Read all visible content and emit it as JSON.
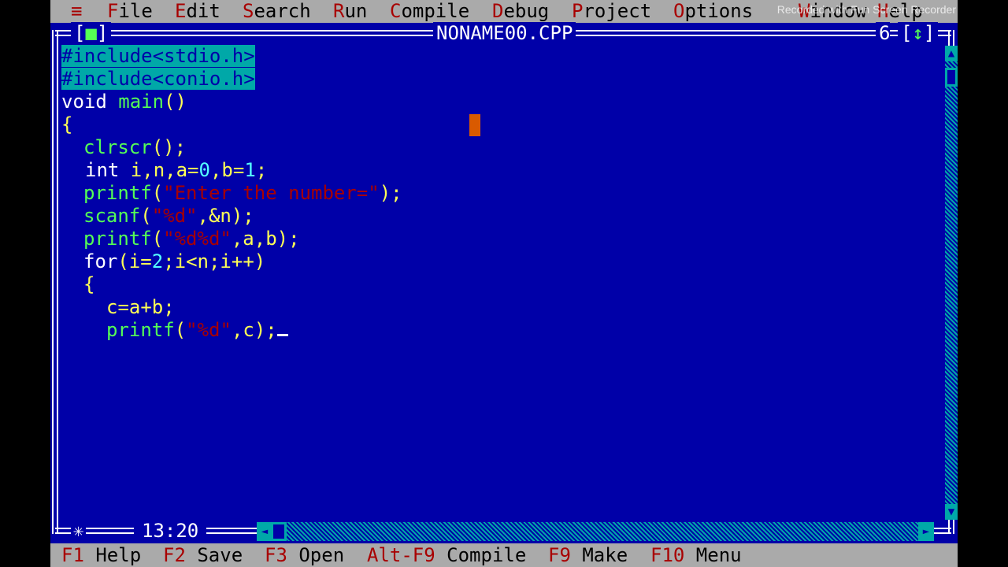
{
  "menu": {
    "system": "≡",
    "items": [
      {
        "hotkey": "F",
        "rest": "ile"
      },
      {
        "hotkey": "E",
        "rest": "dit"
      },
      {
        "hotkey": "S",
        "rest": "earch"
      },
      {
        "hotkey": "R",
        "rest": "un"
      },
      {
        "hotkey": "C",
        "rest": "ompile"
      },
      {
        "hotkey": "D",
        "rest": "ebug"
      },
      {
        "hotkey": "P",
        "rest": "roject"
      },
      {
        "hotkey": "O",
        "rest": "ptions"
      },
      {
        "hotkey": "W",
        "rest": "indow"
      },
      {
        "hotkey": "H",
        "rest": "elp"
      }
    ],
    "watermark": "Recorded with Fun Screen Recorder"
  },
  "window": {
    "close_box_left": "[",
    "close_box_glyph": "■",
    "close_box_right": "]",
    "title": "NONAME00.CPP",
    "number": "6",
    "zoom_box_left": "[",
    "zoom_box_glyph": "↕",
    "zoom_box_right": "]",
    "resize_glyph": "✳",
    "cursor_position": "13:20"
  },
  "scrollbar": {
    "up_glyph": "▲",
    "down_glyph": "▼",
    "left_glyph": "◄",
    "right_glyph": "►"
  },
  "code": {
    "l1": "#include<stdio.h>",
    "l2": "#include<conio.h>",
    "l3a": "void",
    "l3b": " main",
    "l3c": "()",
    "l4": "{",
    "l5a": "clrscr",
    "l5b": "();",
    "l6a": "int",
    "l6b": " i,n,a=",
    "l6c": "0",
    "l6d": ",b=",
    "l6e": "1",
    "l6f": ";",
    "l7a": "printf",
    "l7b": "(",
    "l7c": "\"Enter the number=\"",
    "l7d": ");",
    "l8a": "scanf",
    "l8b": "(",
    "l8c": "\"%d\"",
    "l8d": ",&n);",
    "l9a": "printf",
    "l9b": "(",
    "l9c": "\"%d%d\"",
    "l9d": ",a,b);",
    "l10a": "for",
    "l10b": "(i=",
    "l10c": "2",
    "l10d": ";i<n;i++)",
    "l11": "{",
    "l12": "c=a+b;",
    "l13a": "printf",
    "l13b": "(",
    "l13c": "\"%d\"",
    "l13d": ",c);"
  },
  "status": {
    "items": [
      {
        "key": "F1",
        "label": " Help"
      },
      {
        "key": "F2",
        "label": " Save"
      },
      {
        "key": "F3",
        "label": " Open"
      },
      {
        "key": "Alt-F9",
        "label": " Compile"
      },
      {
        "key": "F9",
        "label": " Make"
      },
      {
        "key": "F10",
        "label": " Menu"
      }
    ]
  },
  "colors": {
    "background": "#0000a8",
    "menu_bar": "#aaaaaa",
    "hotkey": "#a80000",
    "preprocessor_highlight": "#00a8a8",
    "keyword": "#ffffff",
    "identifier": "#ffff55",
    "function": "#55ff55",
    "string": "#a80000",
    "number": "#55ffff"
  }
}
